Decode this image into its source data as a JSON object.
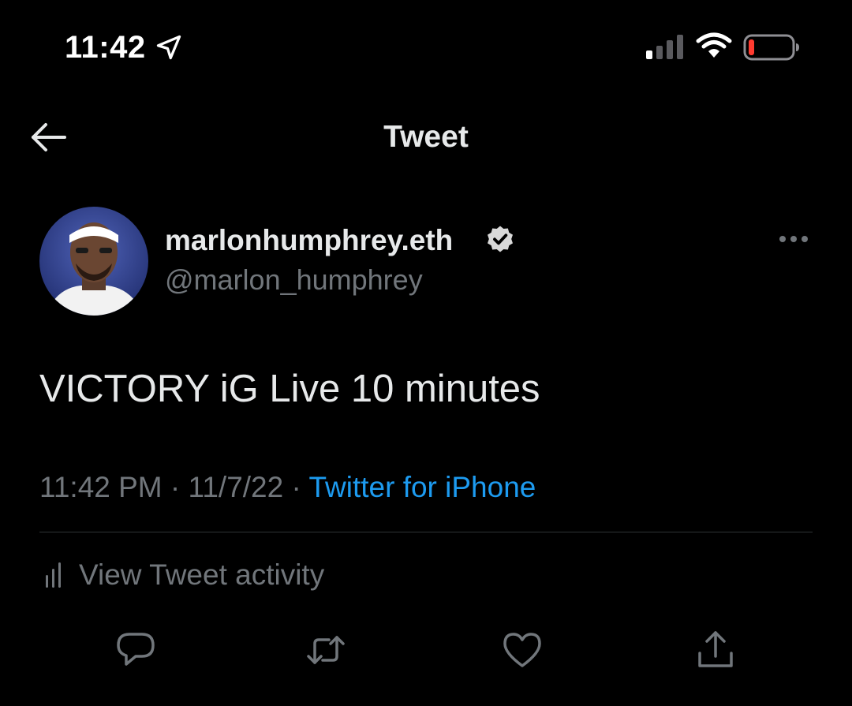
{
  "status_bar": {
    "time": "11:42",
    "icons": [
      "location-arrow-icon",
      "signal-icon",
      "wifi-icon",
      "battery-icon"
    ],
    "battery_level": 0.1,
    "battery_color": "#ff3b30"
  },
  "header": {
    "title": "Tweet",
    "back_icon": "back-arrow-icon"
  },
  "tweet": {
    "display_name": "marlonhumphrey.eth",
    "verified": true,
    "handle": "@marlon_humphrey",
    "text": "VICTORY iG Live 10 minutes",
    "time": "11:42 PM",
    "separator": "·",
    "date": "11/7/22",
    "source": "Twitter for iPhone",
    "more_icon": "more-horizontal-icon"
  },
  "activity": {
    "label": "View Tweet activity",
    "icon": "bar-chart-icon"
  },
  "actions": [
    {
      "name": "reply",
      "icon": "reply-icon"
    },
    {
      "name": "retweet",
      "icon": "retweet-icon"
    },
    {
      "name": "like",
      "icon": "heart-icon"
    },
    {
      "name": "share",
      "icon": "share-icon"
    }
  ],
  "colors": {
    "background": "#000000",
    "primary_text": "#e7e9ea",
    "secondary_text": "#71767b",
    "accent": "#1d9bf0",
    "divider": "#2f3336"
  }
}
